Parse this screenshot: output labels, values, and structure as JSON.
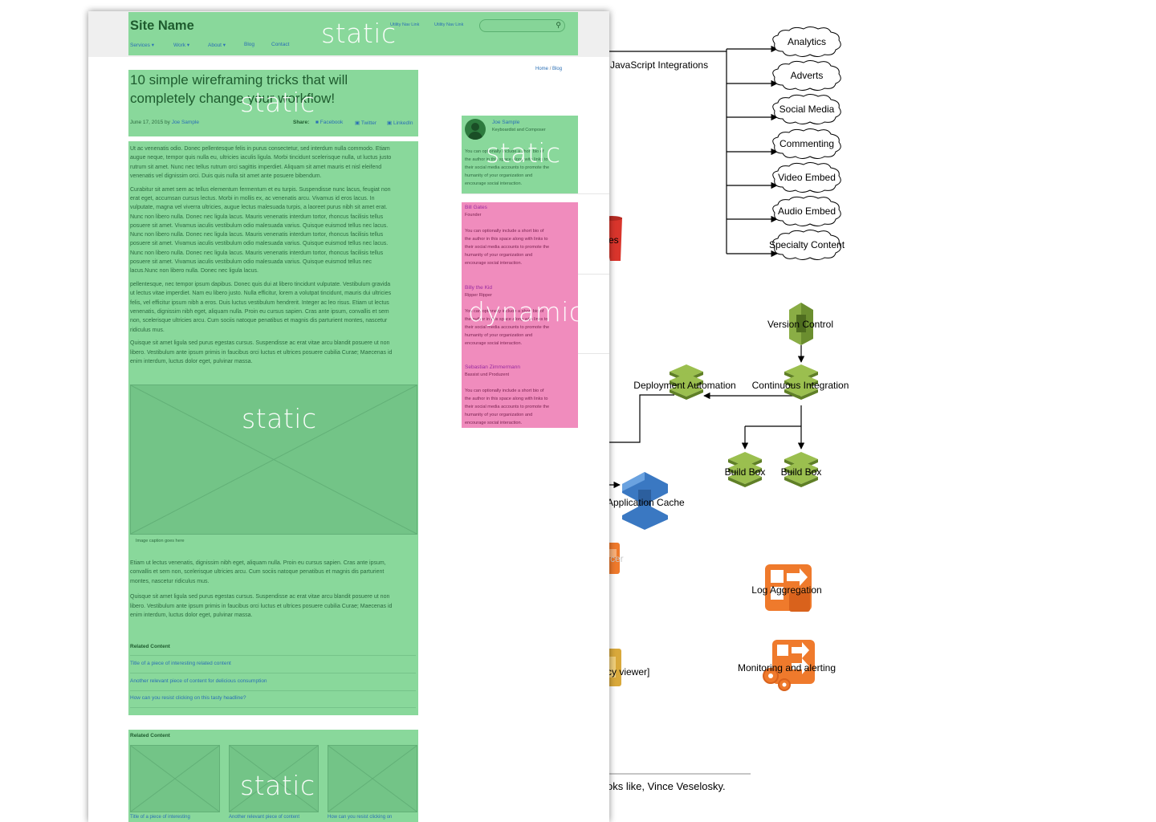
{
  "wireframe": {
    "site_name": "Site Name",
    "utility_links": [
      "Utility Nav Link",
      "Utility Nav Link"
    ],
    "nav": [
      {
        "label": "Services",
        "has_menu": true
      },
      {
        "label": "Work",
        "has_menu": true
      },
      {
        "label": "About",
        "has_menu": true
      },
      {
        "label": "Blog",
        "has_menu": false
      },
      {
        "label": "Contact",
        "has_menu": false
      }
    ],
    "breadcrumb": {
      "home": "Home",
      "sep": "/",
      "current": "Blog"
    },
    "article": {
      "title_line1": "10 simple wireframing tricks that will",
      "title_line2": "completely change your workflow!",
      "date_by": "June 17, 2015 by",
      "author": "Joe Sample",
      "share_label": "Share:",
      "share": [
        "Facebook",
        "Twitter",
        "LinkedIn"
      ],
      "paragraphs": [
        [
          "Ut ac venenatis odio. Donec pellentesque felis in purus consectetur, sed interdum nulla commodo. Etiam",
          "augue neque, tempor quis nulla eu, ultricies iaculis ligula. Morbi tincidunt scelerisque nulla, ut luctus justo",
          "rutrum sit amet. Nunc nec tellus rutrum orci sagittis imperdiet. Aliquam sit amet mauris et nisl eleifend",
          "venenatis vel dignissim orci. Duis quis nulla sit amet ante posuere bibendum."
        ],
        [
          "Curabitur sit amet sem ac tellus elementum fermentum et eu turpis. Suspendisse nunc lacus, feugiat non",
          "erat eget, accumsan cursus lectus. Morbi in mollis ex, ac venenatis arcu. Vivamus id eros lacus. In",
          "vulputate, magna vel viverra ultricies, augue lectus malesuada turpis, a laoreet purus nibh sit amet erat.",
          "Nunc non libero nulla. Donec nec ligula lacus. Mauris venenatis interdum tortor, rhoncus facilisis tellus",
          "posuere sit amet. Vivamus iaculis vestibulum odio malesuada varius. Quisque euismod tellus nec lacus.",
          "Nunc non libero nulla. Donec nec ligula lacus. Mauris venenatis interdum tortor, rhoncus facilisis tellus",
          "posuere sit amet. Vivamus iaculis vestibulum odio malesuada varius. Quisque euismod tellus nec lacus.",
          "Nunc non libero nulla. Donec nec ligula lacus. Mauris venenatis interdum tortor, rhoncus facilisis tellus",
          "posuere sit amet. Vivamus iaculis vestibulum odio malesuada varius. Quisque euismod tellus nec",
          "lacus.Nunc non libero nulla. Donec nec ligula lacus."
        ],
        [
          "pellentesque, nec tempor ipsum dapibus. Donec quis dui at libero tincidunt vulputate. Vestibulum gravida",
          "ut lectus vitae imperdiet. Nam eu libero justo. Nulla efficitur, lorem a volutpat tincidunt, mauris dui ultricies",
          "felis, vel efficitur ipsum nibh a eros. Duis luctus vestibulum hendrerit. Integer ac leo risus. Etiam ut lectus",
          "venenatis, dignissim nibh eget, aliquam nulla. Proin eu cursus sapien. Cras ante ipsum, convallis et sem",
          "non, scelerisque ultricies arcu. Cum sociis natoque penatibus et magnis dis parturient montes, nascetur",
          "ridiculus mus."
        ],
        [
          "Quisque sit amet ligula sed purus egestas cursus. Suspendisse ac erat vitae arcu blandit posuere ut non",
          "libero. Vestibulum ante ipsum primis in faucibus orci luctus et ultrices posuere cubilia Curae; Maecenas id",
          "enim interdum, luctus dolor eget, pulvinar massa."
        ]
      ],
      "image_caption": "Image caption goes here",
      "paragraphs_after": [
        [
          "Etiam ut lectus venenatis, dignissim nibh eget, aliquam nulla. Proin eu cursus sapien. Cras ante ipsum,",
          "convallis et sem non, scelerisque ultricies arcu. Cum sociis natoque penatibus et magnis dis parturient",
          "montes, nascetur ridiculus mus."
        ],
        [
          "Quisque sit amet ligula sed purus egestas cursus. Suspendisse ac erat vitae arcu blandit posuere ut non",
          "libero. Vestibulum ante ipsum primis in faucibus orci luctus et ultrices posuere cubilia Curae; Maecenas id",
          "enim interdum, luctus dolor eget, pulvinar massa."
        ]
      ],
      "related_heading": "Related Content",
      "related_links": [
        "Title of a piece of interesting related content",
        "Another relevant piece of content for delicious consumption",
        "How can you resist clicking on this tasty headline?"
      ]
    },
    "related_grid": {
      "heading": "Related Content",
      "captions": [
        "Title of a piece of interesting",
        "Another relevant piece of content",
        "How can you resist clicking on"
      ]
    },
    "author_bio": {
      "name": "Joe Sample",
      "role": "Keyboardist and Composer",
      "bio": [
        "You can optionally include a short bio of",
        "the author in this space along with links to",
        "their social media accounts to promote the",
        "humanity of your organization and",
        "encourage social interaction."
      ]
    },
    "author_list": [
      {
        "name": "Bill Gates",
        "role": "Founder",
        "bio": [
          "You can optionally include a short bio of",
          "the author in this space along with links to",
          "their social media accounts to promote the",
          "humanity of your organization and",
          "encourage social interaction."
        ]
      },
      {
        "name": "Billy the Kid",
        "role": "Ripper Ripper",
        "bio": [
          "You can optionally include a short bio of",
          "the author in this space along with links to",
          "their social media accounts to promote the",
          "humanity of your organization and",
          "encourage social interaction."
        ]
      },
      {
        "name": "Sebastian Zimmermann",
        "role": "Bassist und Produzent",
        "bio": [
          "You can optionally include a short bio of",
          "the author in this space along with links to",
          "their social media accounts to promote the",
          "humanity of your organization and",
          "encourage social interaction."
        ]
      }
    ],
    "region_labels": {
      "static": "static",
      "dynamic": "dynamic"
    }
  },
  "diagram": {
    "js_integrations": "JavaScript Integrations",
    "clouds": [
      "Analytics",
      "Adverts",
      "Social Media",
      "Commenting",
      "Video Embed",
      "Audio Embed",
      "Specialty Content"
    ],
    "version_control": "Version Control",
    "continuous_integration": "Continuous Integration",
    "deployment_automation": "Deployment Automation",
    "build_boxes": [
      "Build Box",
      "Build Box"
    ],
    "application_cache": "Application Cache",
    "log_aggregation": "Log Aggregation",
    "monitoring": "Monitoring and alerting",
    "partial_labels": [
      "es",
      "cer",
      "cy viewer]"
    ],
    "footer_note": "oks like, Vince Veselosky.",
    "colors": {
      "aws_green": "#6b8e2f",
      "aws_blue": "#3a78c2",
      "aws_orange": "#ef7a2c",
      "bucket_red": "#d9352c"
    }
  }
}
